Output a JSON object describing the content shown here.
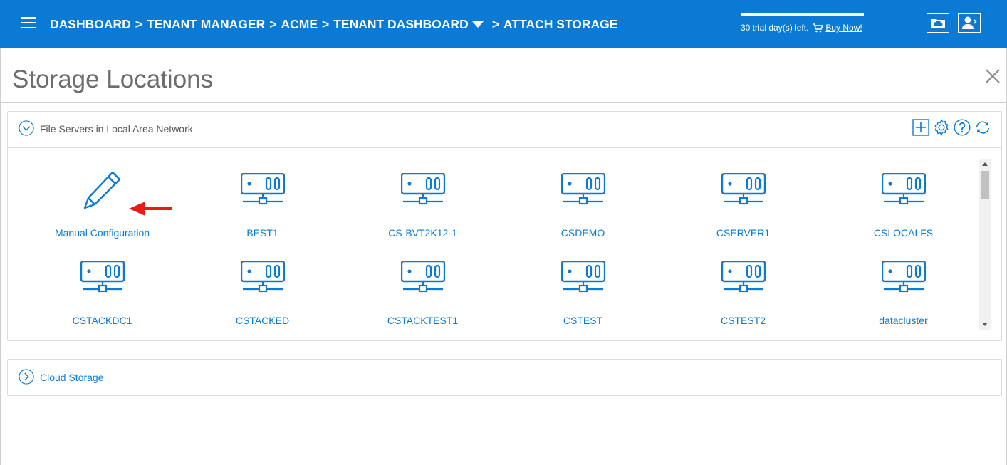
{
  "header": {
    "breadcrumb": [
      {
        "label": "DASHBOARD",
        "has_caret": false
      },
      {
        "label": "TENANT MANAGER",
        "has_caret": false
      },
      {
        "label": "ACME",
        "has_caret": false
      },
      {
        "label": "TENANT DASHBOARD",
        "has_caret": true
      },
      {
        "label": "ATTACH STORAGE",
        "has_caret": false
      }
    ],
    "separator": ">",
    "trial_text": "30 trial day(s) left.",
    "buy_now": "Buy Now!",
    "icons": [
      "menu-icon",
      "cloud-folder-icon",
      "user-account-icon",
      "cart-icon"
    ]
  },
  "page": {
    "title": "Storage Locations"
  },
  "lan_panel": {
    "label": "File Servers in Local Area Network",
    "expanded": true,
    "tools": [
      "add-icon",
      "settings-icon",
      "help-icon",
      "refresh-icon"
    ],
    "items": [
      {
        "label": "Manual Configuration",
        "icon": "pencil-icon"
      },
      {
        "label": "BEST1",
        "icon": "server-icon"
      },
      {
        "label": "CS-BVT2K12-1",
        "icon": "server-icon"
      },
      {
        "label": "CSDEMO",
        "icon": "server-icon"
      },
      {
        "label": "CSERVER1",
        "icon": "server-icon"
      },
      {
        "label": "CSLOCALFS",
        "icon": "server-icon"
      },
      {
        "label": "CSTACKDC1",
        "icon": "server-icon"
      },
      {
        "label": "CSTACKED",
        "icon": "server-icon"
      },
      {
        "label": "CSTACKTEST1",
        "icon": "server-icon"
      },
      {
        "label": "CSTEST",
        "icon": "server-icon"
      },
      {
        "label": "CSTEST2",
        "icon": "server-icon"
      },
      {
        "label": "datacluster",
        "icon": "server-icon"
      }
    ]
  },
  "cloud_panel": {
    "label": "Cloud Storage",
    "expanded": false
  },
  "colors": {
    "brand_blue": "#0a7ad4",
    "annotation_red": "#e81b1b",
    "title_gray": "#6d6d6d"
  }
}
